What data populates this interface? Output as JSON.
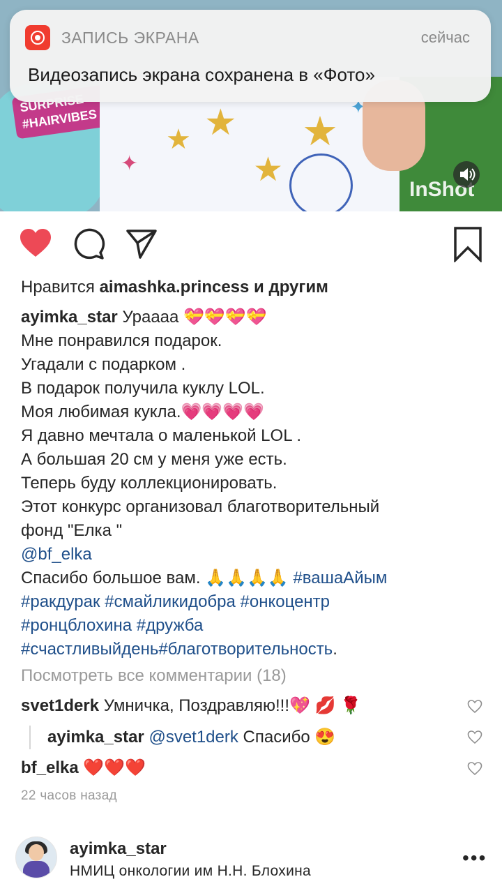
{
  "notification": {
    "app_name": "ЗАПИСЬ ЭКРАНА",
    "time": "сейчас",
    "message": "Видеозапись экрана сохранена в «Фото»"
  },
  "media": {
    "toy_text_1": "SURPRISE",
    "toy_text_2": "#HAIRVIBES",
    "watermark": "InShot"
  },
  "likes": {
    "prefix": "Нравится ",
    "user": "aimashka.princess",
    "suffix": " и другим"
  },
  "caption": {
    "author": "ayimka_star",
    "lines": [
      "Урaааа 💝💝💝💝",
      "Мне понравился подарок.",
      "Угадали с подарком .",
      "В подарок получила куклу LOL.",
      "Моя любимая кукла.💗💗💗💗",
      "Я давно мечтала о  маленькой LOL .",
      "А большая 20 см у меня уже есть.",
      "Теперь буду коллекционировать.",
      "Этот конкурс организовал благотворительный",
      "фонд \"Елка \""
    ],
    "mention": "@bf_elka",
    "thanks": "Спасибо большое вам. 🙏🙏🙏🙏 ",
    "hashtag_1": "#вашаАйым",
    "hashtags_line_2": "#ракдурак #смайликидобра #онкоцентр",
    "hashtags_line_3": "#ронцблохина #дружба",
    "hashtags_line_4": "#счастливыйдень#благотворительность",
    "end_dot": "."
  },
  "view_all_comments": "Посмотреть все комментарии (18)",
  "comments": [
    {
      "user": "svet1derk",
      "text": " Умничка, Поздравляю!!!💖 💋 🌹"
    },
    {
      "user": "ayimka_star",
      "mention": " @svet1derk",
      "text": " Спасибо 😍"
    },
    {
      "user": "bf_elka",
      "text": " ❤️❤️❤️"
    }
  ],
  "time_ago": "22 часов назад",
  "next_post": {
    "user": "ayimka_star",
    "location": "НМИЦ онкологии им Н.Н. Блохина",
    "more": "•••"
  },
  "colors": {
    "like_red": "#ED4956",
    "link_blue": "#1F4F8A",
    "notif_red": "#F03C2F"
  }
}
